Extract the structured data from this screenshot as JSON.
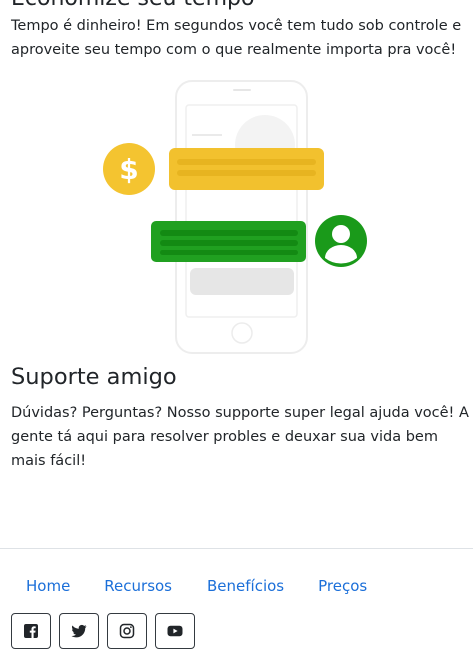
{
  "section1": {
    "title": "Economize seu tempo",
    "text": "Tempo é dinheiro! Em segundos você tem tudo sob controle e aproveite seu tempo com o que realmente importa pra você!"
  },
  "illustration": {
    "currency_symbol": "$",
    "colors": {
      "coin": "#f4c430",
      "bubble_yellow": "#f2c12e",
      "bubble_green": "#20a020",
      "avatar": "#1a9a1a",
      "phone_outline": "#f0f0f0"
    },
    "icons": [
      "dollar-coin-icon",
      "user-avatar-icon",
      "smartphone-icon"
    ]
  },
  "section2": {
    "title": "Suporte amigo",
    "text": "Dúvidas? Perguntas? Nosso supporte super legal ajuda você! A gente tá aqui para resolver probles e deuxar sua vida bem mais fácil!"
  },
  "footer": {
    "nav": [
      "Home",
      "Recursos",
      "Benefícios",
      "Preços"
    ],
    "social": [
      {
        "name": "facebook",
        "icon": "facebook-icon"
      },
      {
        "name": "twitter",
        "icon": "twitter-icon"
      },
      {
        "name": "instagram",
        "icon": "instagram-icon"
      },
      {
        "name": "youtube",
        "icon": "youtube-icon"
      }
    ],
    "link_color": "#1b6fd9"
  }
}
